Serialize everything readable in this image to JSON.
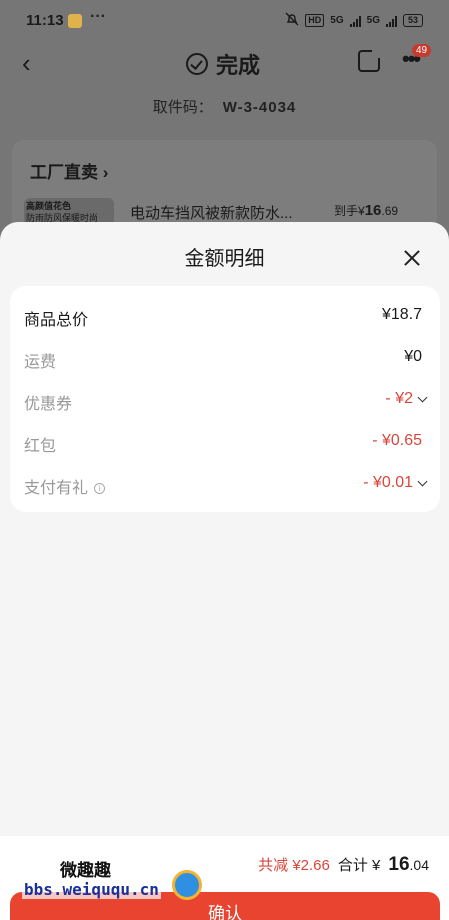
{
  "status_bar": {
    "time": "11:13",
    "more": "···",
    "hd": "HD",
    "net1": "5G",
    "net2": "5G",
    "battery": "53"
  },
  "nav": {
    "title": "完成",
    "badge": "49"
  },
  "pickup": {
    "label": "取件码：",
    "code": "W-3-4034"
  },
  "background_card": {
    "section": "工厂直卖 ›",
    "thumb_text_1": "高颜值花色",
    "thumb_text_2": "防雨防风保暖时尚",
    "product_name": "电动车挡风被新款防水...",
    "price_prefix": "到手¥",
    "price_main": "16",
    "price_decimal": ".69"
  },
  "sheet": {
    "title": "金额明细",
    "rows": [
      {
        "label": "商品总价",
        "value": "¥18.7"
      },
      {
        "label": "运费",
        "value": "¥0"
      },
      {
        "label": "优惠券",
        "value": "- ¥2"
      },
      {
        "label": "红包",
        "value": "- ¥0.65"
      },
      {
        "label": "支付有礼",
        "value": "- ¥0.01"
      }
    ],
    "info_icon_glyph": "i"
  },
  "bottom": {
    "saved": "共减 ¥2.66",
    "total_label": "合计 ¥",
    "total_main": "16",
    "total_decimal": ".04",
    "confirm": "确认"
  },
  "watermark": {
    "line1": "微趣趣",
    "line2": "bbs.weiququ.cn"
  },
  "colors": {
    "accent_red": "#e8442f",
    "discount_red": "#d9463a",
    "overlay": "#767676",
    "sheet_bg": "#f5f5f5"
  }
}
